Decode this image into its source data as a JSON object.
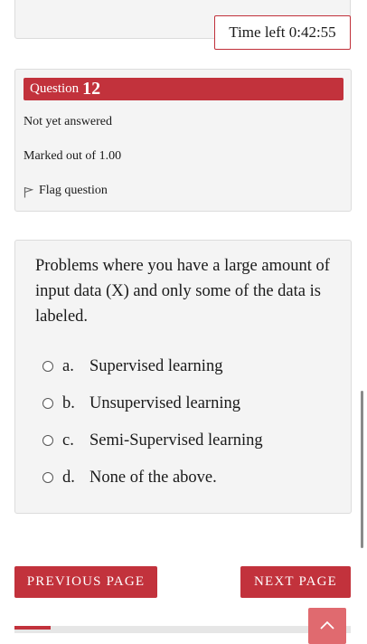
{
  "timer": {
    "text": "Time left 0:42:55"
  },
  "question_info": {
    "label": "Question",
    "number": "12",
    "status": "Not yet answered",
    "marks": "Marked out of 1.00",
    "flag_label": "Flag question"
  },
  "question": {
    "text": "Problems where you have a large amount of input data (X) and only some of the data is labeled.",
    "options": [
      {
        "letter": "a.",
        "text": "Supervised learning"
      },
      {
        "letter": "b.",
        "text": "Unsupervised learning"
      },
      {
        "letter": "c.",
        "text": "Semi-Supervised learning"
      },
      {
        "letter": "d.",
        "text": "None of the above."
      }
    ]
  },
  "navigation": {
    "previous_label": "PREVIOUS PAGE",
    "next_label": "NEXT PAGE"
  },
  "icons": {
    "flag": "flag-outline-icon",
    "back_to_top": "chevron-up-icon"
  },
  "colors": {
    "accent": "#c2323c",
    "card_bg": "#f4f4f4"
  }
}
